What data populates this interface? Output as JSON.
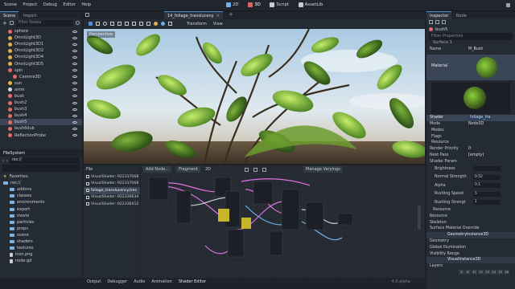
{
  "menubar": {
    "items": [
      "Scene",
      "Project",
      "Debug",
      "Editor",
      "Help"
    ],
    "workspaces": [
      {
        "label": "2D",
        "icon": "2d-icon",
        "active": false
      },
      {
        "label": "3D",
        "icon": "3d-icon",
        "active": true
      },
      {
        "label": "Script",
        "icon": "script-icon",
        "active": false
      },
      {
        "label": "AssetLib",
        "icon": "assetlib-icon",
        "active": false
      }
    ]
  },
  "scene_dock": {
    "tabs": [
      "Scene",
      "Import"
    ],
    "filter_placeholder": "Filter Nodes",
    "nodes": [
      {
        "label": "sphere",
        "color": "#e06c6c",
        "indent": 1
      },
      {
        "label": "OmniLight3D",
        "color": "#e0b04a",
        "indent": 1
      },
      {
        "label": "OmniLight3D1",
        "color": "#e0b04a",
        "indent": 1
      },
      {
        "label": "OmniLight3D2",
        "color": "#e0b04a",
        "indent": 1
      },
      {
        "label": "OmniLight3D4",
        "color": "#e0b04a",
        "indent": 1
      },
      {
        "label": "OmniLight3D5",
        "color": "#e0b04a",
        "indent": 1
      },
      {
        "label": "spin",
        "color": "#e06c6c",
        "indent": 1
      },
      {
        "label": "Camera3D",
        "color": "#e06c6c",
        "indent": 2
      },
      {
        "label": "sun",
        "color": "#e0b04a",
        "indent": 1
      },
      {
        "label": "anim",
        "color": "#d0d5dc",
        "indent": 1
      },
      {
        "label": "bush",
        "color": "#e06c6c",
        "indent": 1
      },
      {
        "label": "bush2",
        "color": "#e06c6c",
        "indent": 1
      },
      {
        "label": "bush3",
        "color": "#e06c6c",
        "indent": 1
      },
      {
        "label": "bush4",
        "color": "#e06c6c",
        "indent": 1
      },
      {
        "label": "bush5",
        "color": "#e06c6c",
        "indent": 1,
        "selected": true
      },
      {
        "label": "bush6dub",
        "color": "#e06c6c",
        "indent": 1
      },
      {
        "label": "ReflectionProbe",
        "color": "#e06c6c",
        "indent": 1
      }
    ]
  },
  "filesystem": {
    "title": "FileSystem",
    "path": "res://",
    "items": [
      {
        "label": "Favorites:",
        "type": "fav",
        "indent": 0
      },
      {
        "label": "res://",
        "type": "folder",
        "indent": 0
      },
      {
        "label": "addons",
        "type": "folder",
        "indent": 1
      },
      {
        "label": "classes",
        "type": "folder",
        "indent": 1
      },
      {
        "label": "environments",
        "type": "folder",
        "indent": 1
      },
      {
        "label": "export",
        "type": "folder",
        "indent": 1
      },
      {
        "label": "movie",
        "type": "folder",
        "indent": 1
      },
      {
        "label": "particles",
        "type": "folder",
        "indent": 1
      },
      {
        "label": "props",
        "type": "folder",
        "indent": 1
      },
      {
        "label": "scene",
        "type": "folder",
        "indent": 1
      },
      {
        "label": "shaders",
        "type": "folder",
        "indent": 1
      },
      {
        "label": "textures",
        "type": "folder",
        "indent": 1
      },
      {
        "label": "icon.png",
        "type": "file",
        "indent": 1
      },
      {
        "label": "node.gd",
        "type": "file",
        "indent": 1
      }
    ]
  },
  "editor_tabs": {
    "active": "14_foliage_transluceny"
  },
  "viewport": {
    "label": "Perspective",
    "toolbar_labels": [
      "Transform",
      "View"
    ]
  },
  "shader_files": {
    "header": "File",
    "items": [
      {
        "label": "VisualShader::922337068",
        "selected": false
      },
      {
        "label": "VisualShader::922337068",
        "selected": false
      },
      {
        "label": "foliage_translucency.tres",
        "selected": true
      },
      {
        "label": "VisualShader::922336634",
        "selected": false
      },
      {
        "label": "VisualShader::922336412",
        "selected": false
      }
    ]
  },
  "shader_toolbar": {
    "add_node": "Add Node...",
    "mode": "Fragment",
    "mode_2": "2D",
    "manage_varyings": "Manage Varyings"
  },
  "bottom_tabs": [
    "Output",
    "Debugger",
    "Audio",
    "Animation",
    "Shader Editor"
  ],
  "version": "4.0.alpha",
  "inspector": {
    "tabs": [
      "Inspector",
      "Node"
    ],
    "node_name": "bush5",
    "filter_placeholder": "Filter Properties",
    "section": "Surface 1",
    "name_label": "Name",
    "name_value": "M_Bush",
    "material_label": "Material",
    "shader_label": "Shader",
    "shader_value": "foliage_tra",
    "mode_label": "Mode",
    "mode_value": "Node3D",
    "groups": [
      "Modes",
      "Flags",
      "Resource"
    ],
    "render_priority_label": "Render Priority",
    "render_priority_value": "0",
    "next_pass_label": "Next Pass",
    "next_pass_value": "[empty]",
    "shader_param": "Shader Param",
    "params": [
      {
        "label": "Brightness",
        "value": ""
      },
      {
        "label": "Normal Strength",
        "value": "0.52"
      },
      {
        "label": "Alpha",
        "value": "0.1"
      },
      {
        "label": "Rustling Speed",
        "value": "5"
      },
      {
        "label": "Rustling Strengt",
        "value": "1"
      }
    ],
    "resource_label": "Resource",
    "bottom_sections": [
      {
        "label": "Resource",
        "badge": ""
      },
      {
        "label": "Skeleton",
        "badge": ""
      },
      {
        "label": "Surface Material Override",
        "badge": ""
      },
      {
        "label": "",
        "badge": "GeometryInstance3D"
      },
      {
        "label": "Geometry",
        "badge": ""
      },
      {
        "label": "Global Illumination",
        "badge": ""
      },
      {
        "label": "Visibility Range",
        "badge": ""
      },
      {
        "label": "",
        "badge": "VisualInstance3D"
      }
    ],
    "layers_label": "Layers",
    "layer_numbers": [
      "5",
      "6",
      "11",
      "12",
      "13",
      "14",
      "15",
      "16"
    ]
  },
  "colors": {
    "accent": "#4f8fd8",
    "panel": "#252b33",
    "background": "#1d2229"
  }
}
